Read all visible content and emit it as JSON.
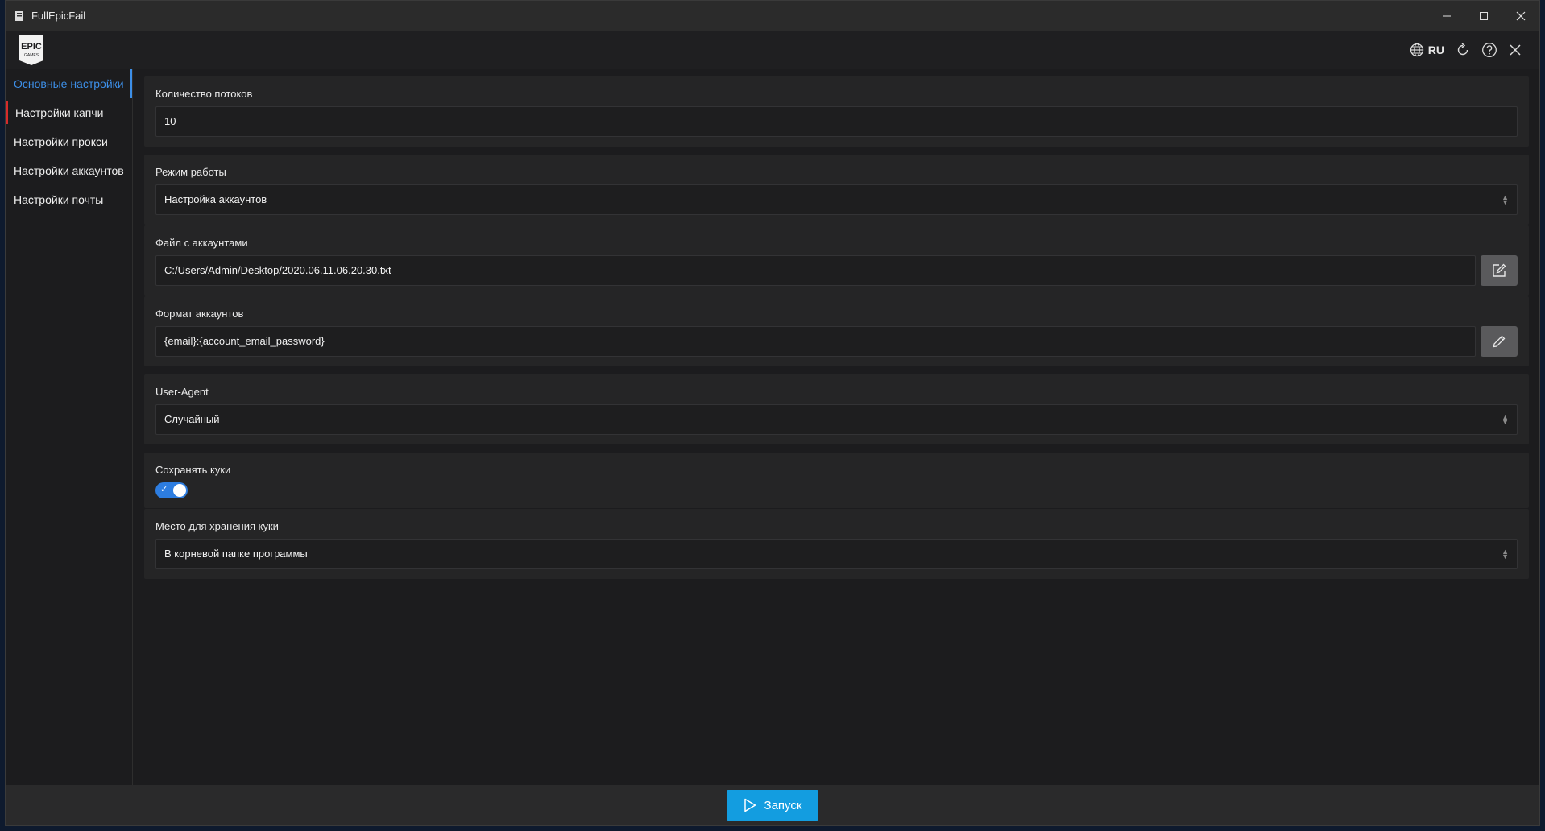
{
  "window": {
    "title": "FullEpicFail"
  },
  "header": {
    "logo_text": "EPIC",
    "logo_subtext": "GAMES",
    "language": "RU"
  },
  "sidebar": {
    "items": [
      {
        "label": "Основные настройки"
      },
      {
        "label": "Настройки капчи"
      },
      {
        "label": "Настройки прокси"
      },
      {
        "label": "Настройки аккаунтов"
      },
      {
        "label": "Настройки почты"
      }
    ]
  },
  "fields": {
    "threads": {
      "label": "Количество потоков",
      "value": "10"
    },
    "mode": {
      "label": "Режим работы",
      "value": "Настройка аккаунтов"
    },
    "accounts_file": {
      "label": "Файл с аккаунтами",
      "value": "C:/Users/Admin/Desktop/2020.06.11.06.20.30.txt"
    },
    "accounts_format": {
      "label": "Формат аккаунтов",
      "value": "{email}:{account_email_password}"
    },
    "user_agent": {
      "label": "User-Agent",
      "value": "Случайный"
    },
    "save_cookies": {
      "label": "Сохранять куки",
      "enabled": true
    },
    "cookie_location": {
      "label": "Место для хранения куки",
      "value": "В корневой папке программы"
    }
  },
  "footer": {
    "launch_label": "Запуск"
  },
  "colors": {
    "accent": "#139de0",
    "active_nav": "#3d8fe8",
    "toggle_on": "#2d7de0",
    "marker": "#d62b2b"
  }
}
